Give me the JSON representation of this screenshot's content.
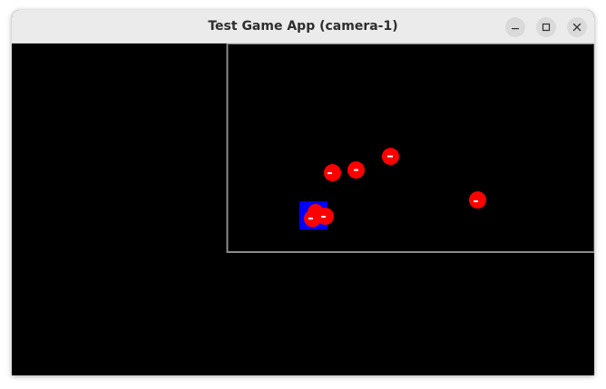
{
  "window": {
    "title": "Test Game App (camera-1)"
  },
  "titlebar_buttons": [
    {
      "name": "minimize",
      "icon": "minimize-icon"
    },
    {
      "name": "maximize",
      "icon": "maximize-icon"
    },
    {
      "name": "close",
      "icon": "close-icon"
    }
  ],
  "game": {
    "background_color": "#000000",
    "bounds_color": "#8a8a8a",
    "enemy_color": "#ff0000",
    "player_color": "#0000ff",
    "enemy_count": 7,
    "player_count": 1
  }
}
